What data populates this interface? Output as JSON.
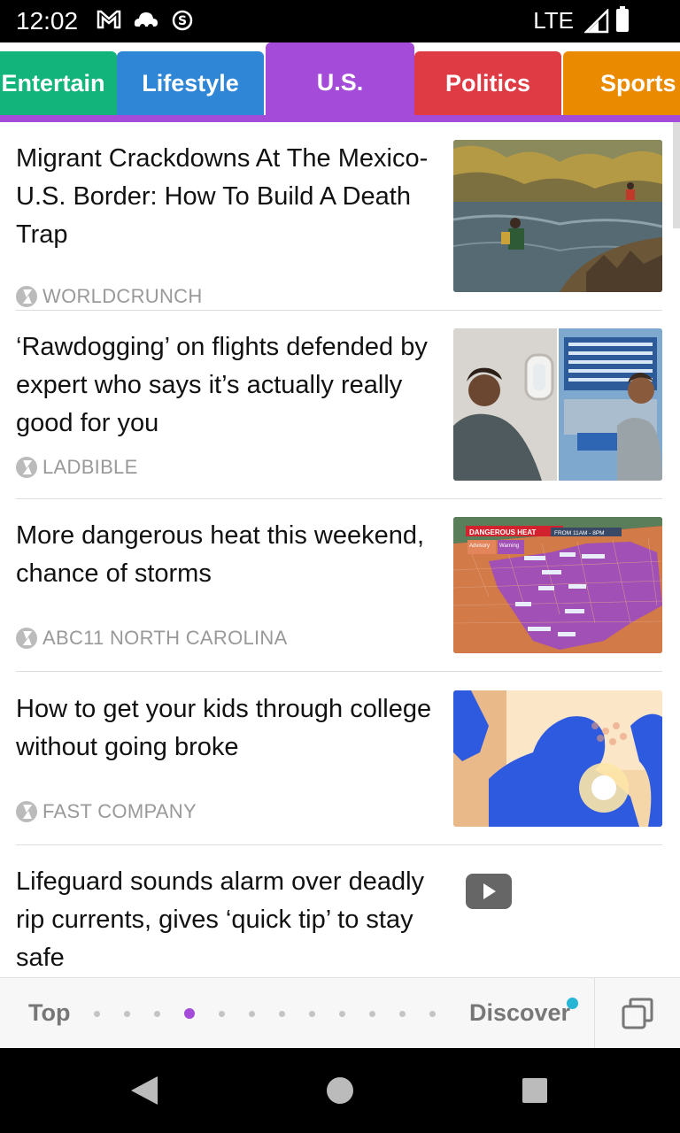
{
  "status_bar": {
    "time": "12:02",
    "network": "LTE"
  },
  "tabs": [
    {
      "label": "Entertain"
    },
    {
      "label": "Lifestyle"
    },
    {
      "label": "U.S."
    },
    {
      "label": "Politics"
    },
    {
      "label": "Sports"
    }
  ],
  "colors": {
    "active_tab": "#a44cd9",
    "entertainment": "#13b47b",
    "lifestyle": "#2f86d6",
    "politics": "#df3b44",
    "sports": "#ea8a00"
  },
  "articles": [
    {
      "title": "Migrant Crackdowns At The Mexico-U.S. Border: How To Build A Death Trap",
      "source": "WORLDCRUNCH",
      "image": "river-photo"
    },
    {
      "title": "‘Rawdogging’ on flights defended by expert who says it’s actually really good for you",
      "source": "LADBIBLE",
      "image": "airplane-passenger-photo"
    },
    {
      "title": "More dangerous heat this weekend, chance of storms",
      "source": "ABC11 NORTH CAROLINA",
      "image": "weather-map"
    },
    {
      "title": "How to get your kids through college without going broke",
      "source": "FAST COMPANY",
      "image": "illustration"
    },
    {
      "title": "Lifeguard sounds alarm over deadly rip currents, gives ‘quick tip’ to stay safe",
      "source": "",
      "image": "video-icon"
    }
  ],
  "weather_map": {
    "banner": "DANGEROUS HEAT",
    "time": "FROM 11AM - 8PM",
    "advisory": "Advisory",
    "warning": "Warning"
  },
  "bottom_nav": {
    "top_label": "Top",
    "discover_label": "Discover",
    "page_count": 12,
    "active_page": 4
  }
}
